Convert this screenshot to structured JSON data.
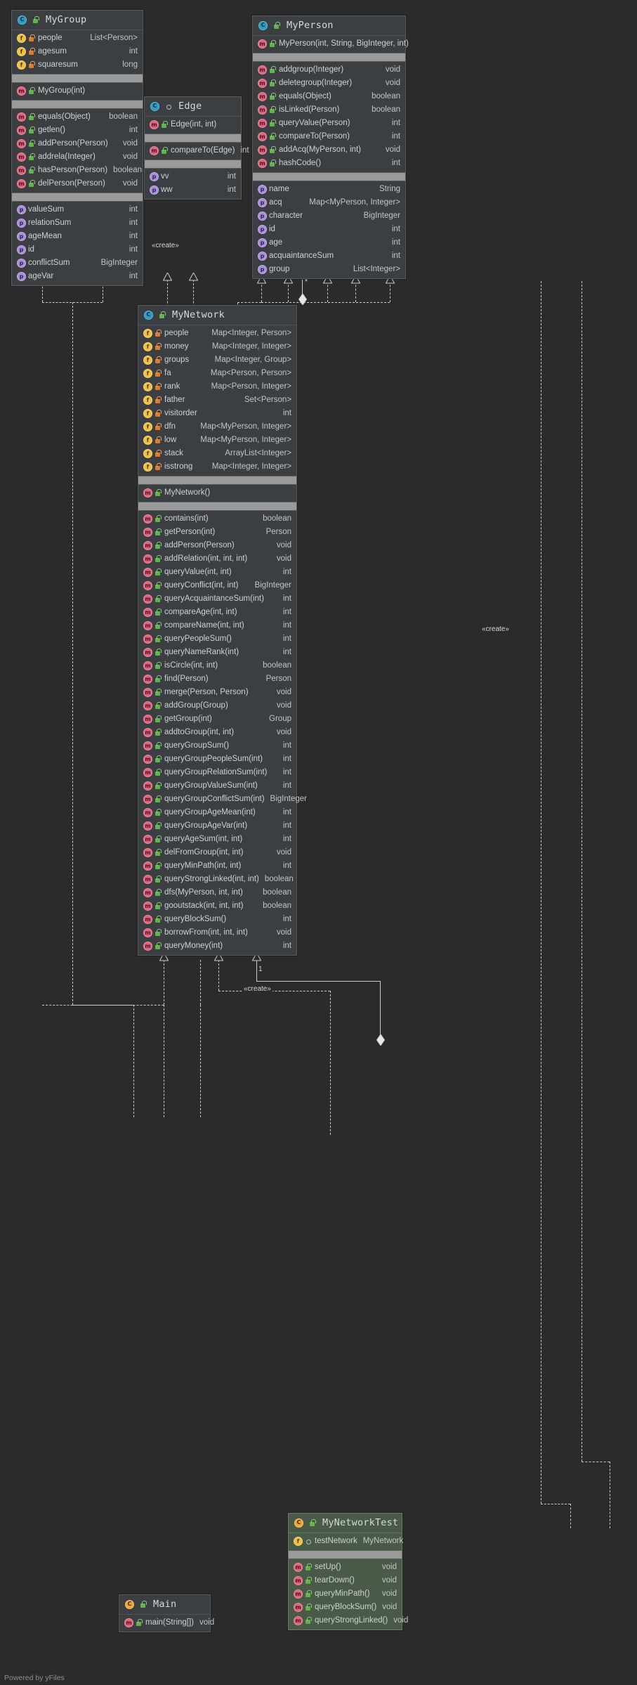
{
  "footer": {
    "text": "Powered by yFiles"
  },
  "icons": {
    "class": "class-icon",
    "method": "method-icon",
    "field": "field-icon",
    "property": "property-icon",
    "lock_public": "unlock-public-icon",
    "lock_private": "lock-private-icon",
    "lock_package": "package-visibility-icon"
  },
  "classes": {
    "mygroup": {
      "title": "MyGroup",
      "fields": [
        {
          "name": "people",
          "type": "List<Person>",
          "vis": "private"
        },
        {
          "name": "agesum",
          "type": "int",
          "vis": "private"
        },
        {
          "name": "squaresum",
          "type": "long",
          "vis": "private"
        }
      ],
      "constructors": [
        {
          "name": "MyGroup(int)",
          "type": "",
          "vis": "public"
        }
      ],
      "methods": [
        {
          "name": "equals(Object)",
          "type": "boolean",
          "vis": "public"
        },
        {
          "name": "getlen()",
          "type": "int",
          "vis": "public"
        },
        {
          "name": "addPerson(Person)",
          "type": "void",
          "vis": "public"
        },
        {
          "name": "addrela(Integer)",
          "type": "void",
          "vis": "public"
        },
        {
          "name": "hasPerson(Person)",
          "type": "boolean",
          "vis": "public"
        },
        {
          "name": "delPerson(Person)",
          "type": "void",
          "vis": "public"
        }
      ],
      "properties": [
        {
          "name": "valueSum",
          "type": "int"
        },
        {
          "name": "relationSum",
          "type": "int"
        },
        {
          "name": "ageMean",
          "type": "int"
        },
        {
          "name": "id",
          "type": "int"
        },
        {
          "name": "conflictSum",
          "type": "BigInteger"
        },
        {
          "name": "ageVar",
          "type": "int"
        }
      ]
    },
    "edge": {
      "title": "Edge",
      "constructors": [
        {
          "name": "Edge(int, int)",
          "type": "",
          "vis": "public"
        }
      ],
      "methods": [
        {
          "name": "compareTo(Edge)",
          "type": "int",
          "vis": "public"
        }
      ],
      "properties": [
        {
          "name": "vv",
          "type": "int"
        },
        {
          "name": "ww",
          "type": "int"
        }
      ]
    },
    "myperson": {
      "title": "MyPerson",
      "constructors": [
        {
          "name": "MyPerson(int, String, BigInteger, int)",
          "type": "",
          "vis": "public"
        }
      ],
      "methods": [
        {
          "name": "addgroup(Integer)",
          "type": "void",
          "vis": "public"
        },
        {
          "name": "deletegroup(Integer)",
          "type": "void",
          "vis": "public"
        },
        {
          "name": "equals(Object)",
          "type": "boolean",
          "vis": "public"
        },
        {
          "name": "isLinked(Person)",
          "type": "boolean",
          "vis": "public"
        },
        {
          "name": "queryValue(Person)",
          "type": "int",
          "vis": "public"
        },
        {
          "name": "compareTo(Person)",
          "type": "int",
          "vis": "public"
        },
        {
          "name": "addAcq(MyPerson, int)",
          "type": "void",
          "vis": "public"
        },
        {
          "name": "hashCode()",
          "type": "int",
          "vis": "public"
        }
      ],
      "properties": [
        {
          "name": "name",
          "type": "String"
        },
        {
          "name": "acq",
          "type": "Map<MyPerson, Integer>"
        },
        {
          "name": "character",
          "type": "BigInteger"
        },
        {
          "name": "id",
          "type": "int"
        },
        {
          "name": "age",
          "type": "int"
        },
        {
          "name": "acquaintanceSum",
          "type": "int"
        },
        {
          "name": "group",
          "type": "List<Integer>"
        }
      ]
    },
    "mynetwork": {
      "title": "MyNetwork",
      "fields": [
        {
          "name": "people",
          "type": "Map<Integer, Person>",
          "vis": "private"
        },
        {
          "name": "money",
          "type": "Map<Integer, Integer>",
          "vis": "private"
        },
        {
          "name": "groups",
          "type": "Map<Integer, Group>",
          "vis": "private"
        },
        {
          "name": "fa",
          "type": "Map<Person, Person>",
          "vis": "private"
        },
        {
          "name": "rank",
          "type": "Map<Person, Integer>",
          "vis": "private"
        },
        {
          "name": "father",
          "type": "Set<Person>",
          "vis": "private"
        },
        {
          "name": "visitorder",
          "type": "int",
          "vis": "private"
        },
        {
          "name": "dfn",
          "type": "Map<MyPerson, Integer>",
          "vis": "private"
        },
        {
          "name": "low",
          "type": "Map<MyPerson, Integer>",
          "vis": "private"
        },
        {
          "name": "stack",
          "type": "ArrayList<Integer>",
          "vis": "private"
        },
        {
          "name": "isstrong",
          "type": "Map<Integer, Integer>",
          "vis": "private"
        }
      ],
      "constructors": [
        {
          "name": "MyNetwork()",
          "type": "",
          "vis": "public"
        }
      ],
      "methods": [
        {
          "name": "contains(int)",
          "type": "boolean",
          "vis": "public"
        },
        {
          "name": "getPerson(int)",
          "type": "Person",
          "vis": "public"
        },
        {
          "name": "addPerson(Person)",
          "type": "void",
          "vis": "public"
        },
        {
          "name": "addRelation(int, int, int)",
          "type": "void",
          "vis": "public"
        },
        {
          "name": "queryValue(int, int)",
          "type": "int",
          "vis": "public"
        },
        {
          "name": "queryConflict(int, int)",
          "type": "BigInteger",
          "vis": "public"
        },
        {
          "name": "queryAcquaintanceSum(int)",
          "type": "int",
          "vis": "public"
        },
        {
          "name": "compareAge(int, int)",
          "type": "int",
          "vis": "public"
        },
        {
          "name": "compareName(int, int)",
          "type": "int",
          "vis": "public"
        },
        {
          "name": "queryPeopleSum()",
          "type": "int",
          "vis": "public"
        },
        {
          "name": "queryNameRank(int)",
          "type": "int",
          "vis": "public"
        },
        {
          "name": "isCircle(int, int)",
          "type": "boolean",
          "vis": "public"
        },
        {
          "name": "find(Person)",
          "type": "Person",
          "vis": "public"
        },
        {
          "name": "merge(Person, Person)",
          "type": "void",
          "vis": "public"
        },
        {
          "name": "addGroup(Group)",
          "type": "void",
          "vis": "public"
        },
        {
          "name": "getGroup(int)",
          "type": "Group",
          "vis": "public"
        },
        {
          "name": "addtoGroup(int, int)",
          "type": "void",
          "vis": "public"
        },
        {
          "name": "queryGroupSum()",
          "type": "int",
          "vis": "public"
        },
        {
          "name": "queryGroupPeopleSum(int)",
          "type": "int",
          "vis": "public"
        },
        {
          "name": "queryGroupRelationSum(int)",
          "type": "int",
          "vis": "public"
        },
        {
          "name": "queryGroupValueSum(int)",
          "type": "int",
          "vis": "public"
        },
        {
          "name": "queryGroupConflictSum(int)",
          "type": "BigInteger",
          "vis": "public"
        },
        {
          "name": "queryGroupAgeMean(int)",
          "type": "int",
          "vis": "public"
        },
        {
          "name": "queryGroupAgeVar(int)",
          "type": "int",
          "vis": "public"
        },
        {
          "name": "queryAgeSum(int, int)",
          "type": "int",
          "vis": "public"
        },
        {
          "name": "delFromGroup(int, int)",
          "type": "void",
          "vis": "public"
        },
        {
          "name": "queryMinPath(int, int)",
          "type": "int",
          "vis": "public"
        },
        {
          "name": "queryStrongLinked(int, int)",
          "type": "boolean",
          "vis": "public"
        },
        {
          "name": "dfs(MyPerson, int, int)",
          "type": "boolean",
          "vis": "public"
        },
        {
          "name": "gooutstack(int, int, int)",
          "type": "boolean",
          "vis": "public"
        },
        {
          "name": "queryBlockSum()",
          "type": "int",
          "vis": "public"
        },
        {
          "name": "borrowFrom(int, int, int)",
          "type": "void",
          "vis": "public"
        },
        {
          "name": "queryMoney(int)",
          "type": "int",
          "vis": "public"
        }
      ]
    },
    "main": {
      "title": "Main",
      "methods": [
        {
          "name": "main(String[])",
          "type": "void",
          "vis": "public"
        }
      ]
    },
    "mynetworktest": {
      "title": "MyNetworkTest",
      "fields": [
        {
          "name": "testNetwork",
          "type": "MyNetwork",
          "vis": "package"
        }
      ],
      "methods": [
        {
          "name": "setUp()",
          "type": "void",
          "vis": "public"
        },
        {
          "name": "tearDown()",
          "type": "void",
          "vis": "public"
        },
        {
          "name": "queryMinPath()",
          "type": "void",
          "vis": "public"
        },
        {
          "name": "queryBlockSum()",
          "type": "void",
          "vis": "public"
        },
        {
          "name": "queryStrongLinked()",
          "type": "void",
          "vis": "public"
        }
      ]
    }
  },
  "connectors": {
    "create_edge": "«create»",
    "create_person": "«create»",
    "create_network": "«create»",
    "mult_star": "*",
    "mult_one": "1"
  }
}
